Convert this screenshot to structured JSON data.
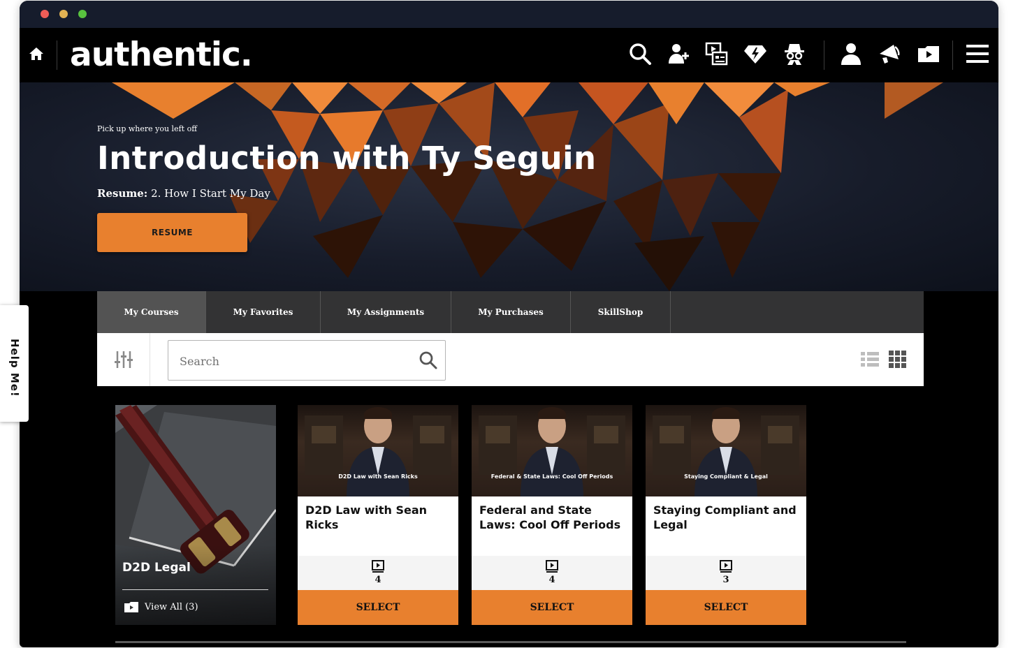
{
  "brand": {
    "logo_text": "authentic.",
    "accent_color": "#e8802e"
  },
  "nav": {
    "icons": [
      "home-icon",
      "search-icon",
      "add-user-icon",
      "video-library-icon",
      "diamond-icon",
      "incognito-icon",
      "user-icon",
      "megaphone-icon",
      "video-folder-icon",
      "hamburger-menu-icon"
    ]
  },
  "hero": {
    "subtitle": "Pick up where you left off",
    "title": "Introduction with Ty Seguin",
    "resume_label": "Resume:",
    "resume_lesson": " 2. How I Start My Day",
    "resume_button": "RESUME"
  },
  "tabs": [
    {
      "label": "My Courses",
      "active": true
    },
    {
      "label": "My Favorites",
      "active": false
    },
    {
      "label": "My Assignments",
      "active": false
    },
    {
      "label": "My Purchases",
      "active": false
    },
    {
      "label": "SkillShop",
      "active": false
    }
  ],
  "search": {
    "placeholder": "Search",
    "value": ""
  },
  "category_card": {
    "title": "D2D Legal",
    "view_all": "View All (3)"
  },
  "courses": [
    {
      "thumb_caption": "D2D Law with Sean Ricks",
      "title": "D2D Law with Sean Ricks",
      "video_count": "4",
      "button": "SELECT"
    },
    {
      "thumb_caption": "Federal & State Laws: Cool Off Periods",
      "title": "Federal and State Laws: Cool Off Periods",
      "video_count": "4",
      "button": "SELECT"
    },
    {
      "thumb_caption": "Staying Compliant & Legal",
      "title": "Staying Compliant and Legal",
      "video_count": "3",
      "button": "SELECT"
    }
  ],
  "help_tab": {
    "label": "Help Me!"
  }
}
